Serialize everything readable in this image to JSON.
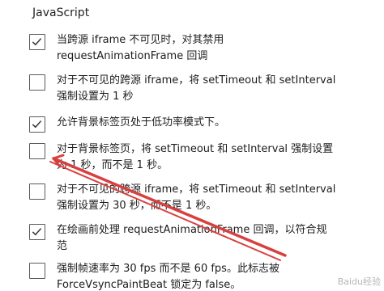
{
  "section": {
    "title": "JavaScript"
  },
  "options": [
    {
      "checked": true,
      "lines": [
        "当跨源 iframe 不可见时，对其禁用",
        "requestAnimationFrame 回调"
      ]
    },
    {
      "checked": false,
      "lines": [
        "对于不可见的跨源 iframe，将 setTimeout 和 setInterval",
        "强制设置为 1 秒"
      ]
    },
    {
      "checked": true,
      "lines": [
        "允许背景标签页处于低功率模式下。"
      ]
    },
    {
      "checked": false,
      "lines": [
        "对于背景标签页，将 setTimeout 和 setInterval 强制设置",
        "为 1 秒，而不是 1 秒。"
      ]
    },
    {
      "checked": false,
      "lines": [
        "对于不可见的跨源 iframe，将 setTimeout 和 setInterval",
        "强制设置为 30 秒，而不是 1 秒。"
      ]
    },
    {
      "checked": true,
      "lines": [
        "在绘画前处理 requestAnimationFrame 回调，以符合规",
        "范"
      ]
    },
    {
      "checked": false,
      "lines": [
        "强制帧速率为 30 fps 而不是 60 fps。此标志被",
        "ForceVsyncPaintBeat 锁定为 false。"
      ]
    }
  ],
  "annotation": {
    "color": "#d8403f"
  },
  "watermark": {
    "text": "Baidu经验"
  }
}
